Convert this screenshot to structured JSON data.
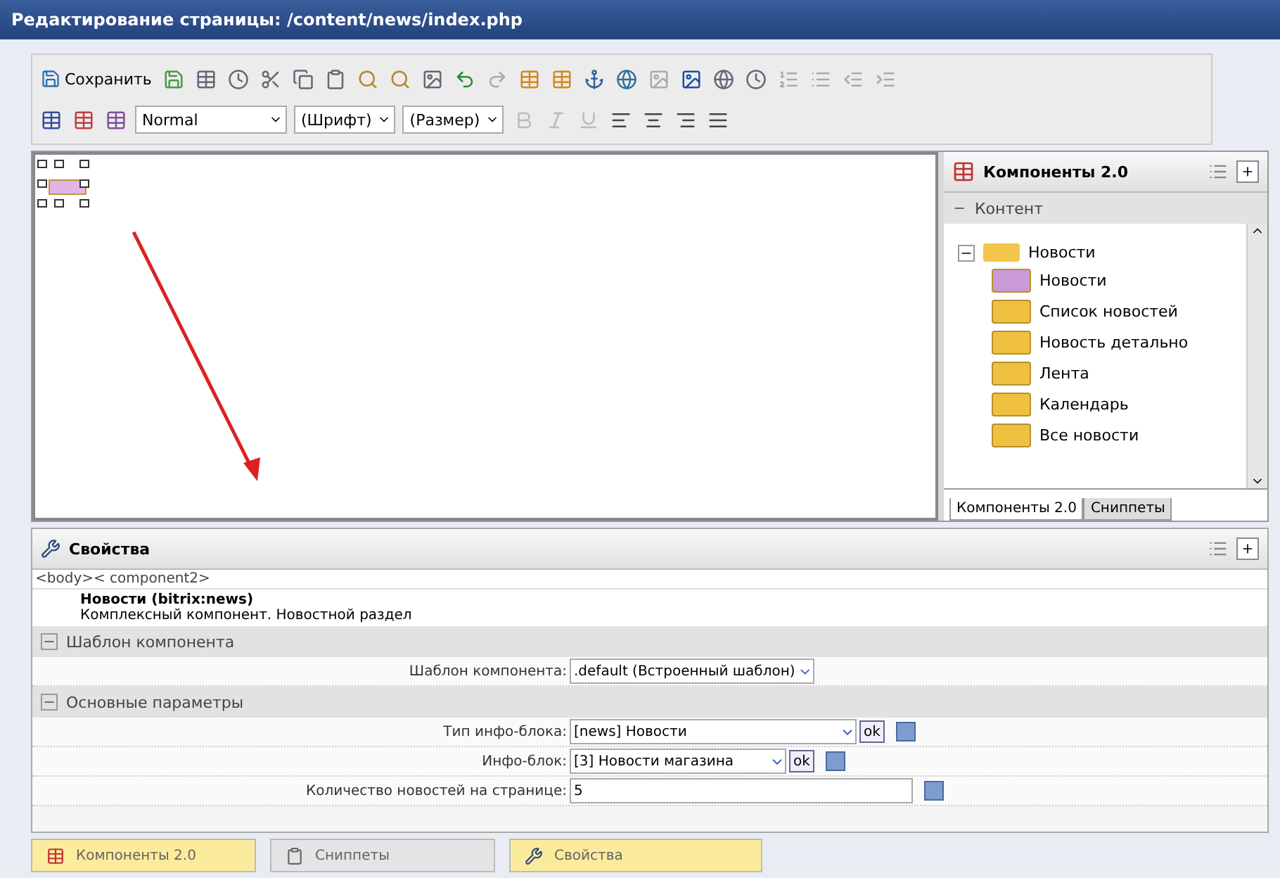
{
  "window": {
    "title": "Редактирование страницы: /content/news/index.php"
  },
  "toolbar": {
    "save_label": "Сохранить",
    "style_select": "Normal",
    "font_select": "(Шрифт)",
    "size_select": "(Размер)"
  },
  "components_panel": {
    "title": "Компоненты 2.0",
    "section": "Контент",
    "section_expanded": true,
    "folder": {
      "label": "Новости",
      "expanded": true,
      "children": [
        {
          "label": "Новости",
          "color": "#c99ad6"
        },
        {
          "label": "Список новостей",
          "color": "#f0c040"
        },
        {
          "label": "Новость детально",
          "color": "#f0c040"
        },
        {
          "label": "Лента",
          "color": "#f0c040"
        },
        {
          "label": "Календарь",
          "color": "#f0c040"
        },
        {
          "label": "Все новости",
          "color": "#f0c040"
        }
      ]
    },
    "tabs": [
      {
        "label": "Компоненты 2.0",
        "selected": true
      },
      {
        "label": "Сниппеты",
        "selected": false
      }
    ]
  },
  "properties": {
    "title": "Свойства",
    "breadcrumb": "<body>< component2>",
    "component_name": "Новости (bitrix:news)",
    "component_desc": "Комплексный компонент. Новостной раздел",
    "groups": [
      {
        "label": "Шаблон компонента",
        "expanded": true,
        "params": [
          {
            "label": "Шаблон компонента:",
            "value": ".default (Встроенный шаблон)",
            "kind": "select"
          }
        ]
      },
      {
        "label": "Основные параметры",
        "expanded": true,
        "params": [
          {
            "label": "Тип инфо-блока:",
            "value": "[news] Новости",
            "kind": "select-ok",
            "ok": "ok"
          },
          {
            "label": "Инфо-блок:",
            "value": "[3] Новости магазина",
            "kind": "select-ok",
            "ok": "ok"
          },
          {
            "label": "Количество новостей на странице:",
            "value": "5",
            "kind": "text"
          }
        ]
      }
    ]
  },
  "bottom_tabs": [
    {
      "label": "Компоненты 2.0",
      "selected": true
    },
    {
      "label": "Сниппеты",
      "selected": false
    },
    {
      "label": "Свойства",
      "selected": true
    }
  ]
}
